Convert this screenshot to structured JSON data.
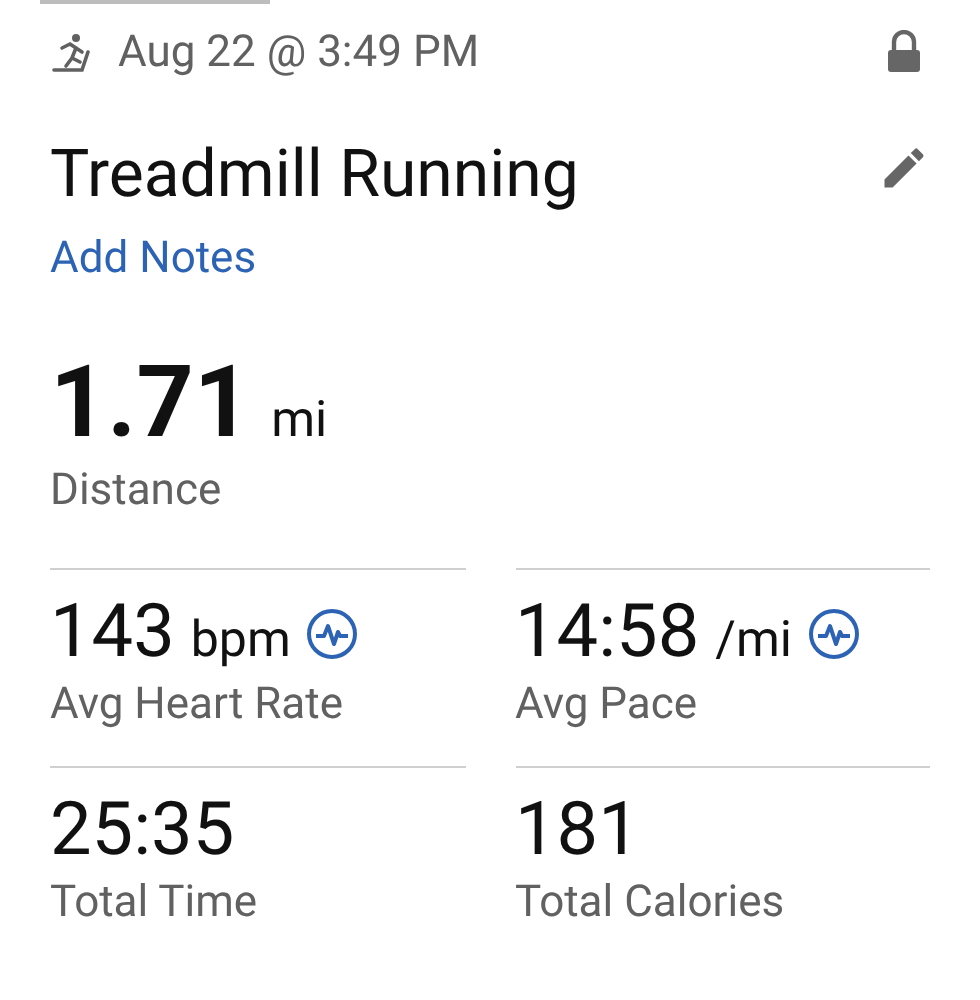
{
  "header": {
    "date": "Aug 22 @ 3:49 PM",
    "locked": true
  },
  "title": "Treadmill Running",
  "notes_link": "Add Notes",
  "primary": {
    "value": "1.71",
    "unit": "mi",
    "label": "Distance"
  },
  "stats": [
    {
      "value": "143",
      "unit": "bpm",
      "label": "Avg Heart Rate",
      "chart_icon": true
    },
    {
      "value": "14:58",
      "unit": "/mi",
      "label": "Avg Pace",
      "chart_icon": true
    },
    {
      "value": "25:35",
      "label": "Total Time",
      "chart_icon": false
    },
    {
      "value": "181",
      "label": "Total Calories",
      "chart_icon": false
    }
  ]
}
